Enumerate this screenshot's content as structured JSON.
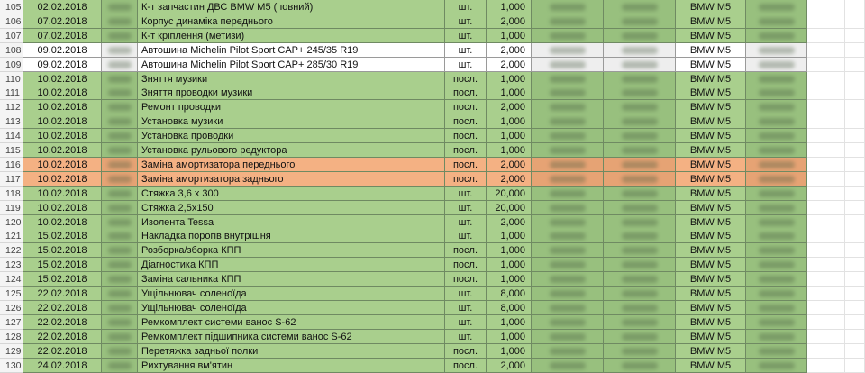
{
  "colors": {
    "green": "#a9cf8d",
    "green_blur": "#98c07e",
    "orange": "#f4b183",
    "orange_blur": "#e6a374",
    "white": "#ffffff",
    "white_blur": "#eeeeee"
  },
  "rows": [
    {
      "num": "105",
      "date": "02.02.2018",
      "name": "К-т запчастин ДВС BMW M5 (повний)",
      "unit": "шт.",
      "qty": "1,000",
      "car": "BMW M5",
      "fill": "green"
    },
    {
      "num": "106",
      "date": "07.02.2018",
      "name": "Корпус динаміка переднього",
      "unit": "шт.",
      "qty": "2,000",
      "car": "BMW M5",
      "fill": "green"
    },
    {
      "num": "107",
      "date": "07.02.2018",
      "name": "К-т кріплення (метизи)",
      "unit": "шт.",
      "qty": "1,000",
      "car": "BMW M5",
      "fill": "green"
    },
    {
      "num": "108",
      "date": "09.02.2018",
      "name": "Автошина Michelin Pilot Sport CAP+ 245/35 R19",
      "unit": "шт.",
      "qty": "2,000",
      "car": "BMW M5",
      "fill": "white"
    },
    {
      "num": "109",
      "date": "09.02.2018",
      "name": "Автошина Michelin Pilot Sport CAP+ 285/30 R19",
      "unit": "шт.",
      "qty": "2,000",
      "car": "BMW M5",
      "fill": "white"
    },
    {
      "num": "110",
      "date": "10.02.2018",
      "name": "Зняття музики",
      "unit": "посл.",
      "qty": "1,000",
      "car": "BMW M5",
      "fill": "green"
    },
    {
      "num": "111",
      "date": "10.02.2018",
      "name": "Зняття проводки музики",
      "unit": "посл.",
      "qty": "1,000",
      "car": "BMW M5",
      "fill": "green"
    },
    {
      "num": "112",
      "date": "10.02.2018",
      "name": "Ремонт проводки",
      "unit": "посл.",
      "qty": "2,000",
      "car": "BMW M5",
      "fill": "green"
    },
    {
      "num": "113",
      "date": "10.02.2018",
      "name": "Установка музики",
      "unit": "посл.",
      "qty": "1,000",
      "car": "BMW M5",
      "fill": "green"
    },
    {
      "num": "114",
      "date": "10.02.2018",
      "name": "Установка проводки",
      "unit": "посл.",
      "qty": "1,000",
      "car": "BMW M5",
      "fill": "green"
    },
    {
      "num": "115",
      "date": "10.02.2018",
      "name": "Установка рульового редуктора",
      "unit": "посл.",
      "qty": "1,000",
      "car": "BMW M5",
      "fill": "green"
    },
    {
      "num": "116",
      "date": "10.02.2018",
      "name": "Заміна амортизатора переднього",
      "unit": "посл.",
      "qty": "2,000",
      "car": "BMW M5",
      "fill": "orange"
    },
    {
      "num": "117",
      "date": "10.02.2018",
      "name": "Заміна амортизатора заднього",
      "unit": "посл.",
      "qty": "2,000",
      "car": "BMW M5",
      "fill": "orange"
    },
    {
      "num": "118",
      "date": "10.02.2018",
      "name": "Стяжка 3,6 х 300",
      "unit": "шт.",
      "qty": "20,000",
      "car": "BMW M5",
      "fill": "green"
    },
    {
      "num": "119",
      "date": "10.02.2018",
      "name": "Стяжка 2,5х150",
      "unit": "шт.",
      "qty": "20,000",
      "car": "BMW M5",
      "fill": "green"
    },
    {
      "num": "120",
      "date": "10.02.2018",
      "name": "Изолента Tessa",
      "unit": "шт.",
      "qty": "2,000",
      "car": "BMW M5",
      "fill": "green"
    },
    {
      "num": "121",
      "date": "15.02.2018",
      "name": "Накладка порогів внутрішня",
      "unit": "шт.",
      "qty": "1,000",
      "car": "BMW M5",
      "fill": "green"
    },
    {
      "num": "122",
      "date": "15.02.2018",
      "name": "Розборка/зборка КПП",
      "unit": "посл.",
      "qty": "1,000",
      "car": "BMW M5",
      "fill": "green"
    },
    {
      "num": "123",
      "date": "15.02.2018",
      "name": "Діагностика КПП",
      "unit": "посл.",
      "qty": "1,000",
      "car": "BMW M5",
      "fill": "green"
    },
    {
      "num": "124",
      "date": "15.02.2018",
      "name": "Заміна сальника КПП",
      "unit": "посл.",
      "qty": "1,000",
      "car": "BMW M5",
      "fill": "green"
    },
    {
      "num": "125",
      "date": "22.02.2018",
      "name": "Ущільнювач соленоїда",
      "unit": "шт.",
      "qty": "8,000",
      "car": "BMW M5",
      "fill": "green"
    },
    {
      "num": "126",
      "date": "22.02.2018",
      "name": "Ущільнювач соленоїда",
      "unit": "шт.",
      "qty": "8,000",
      "car": "BMW M5",
      "fill": "green"
    },
    {
      "num": "127",
      "date": "22.02.2018",
      "name": "Ремкомплект системи ванос S-62",
      "unit": "шт.",
      "qty": "1,000",
      "car": "BMW M5",
      "fill": "green"
    },
    {
      "num": "128",
      "date": "22.02.2018",
      "name": "Ремкомплект підшипника системи ванос S-62",
      "unit": "шт.",
      "qty": "1,000",
      "car": "BMW M5",
      "fill": "green"
    },
    {
      "num": "129",
      "date": "22.02.2018",
      "name": "Перетяжка задньої полки",
      "unit": "посл.",
      "qty": "1,000",
      "car": "BMW M5",
      "fill": "green"
    },
    {
      "num": "130",
      "date": "24.02.2018",
      "name": "Рихтування вм'ятин",
      "unit": "посл.",
      "qty": "2,000",
      "car": "BMW M5",
      "fill": "green"
    }
  ]
}
